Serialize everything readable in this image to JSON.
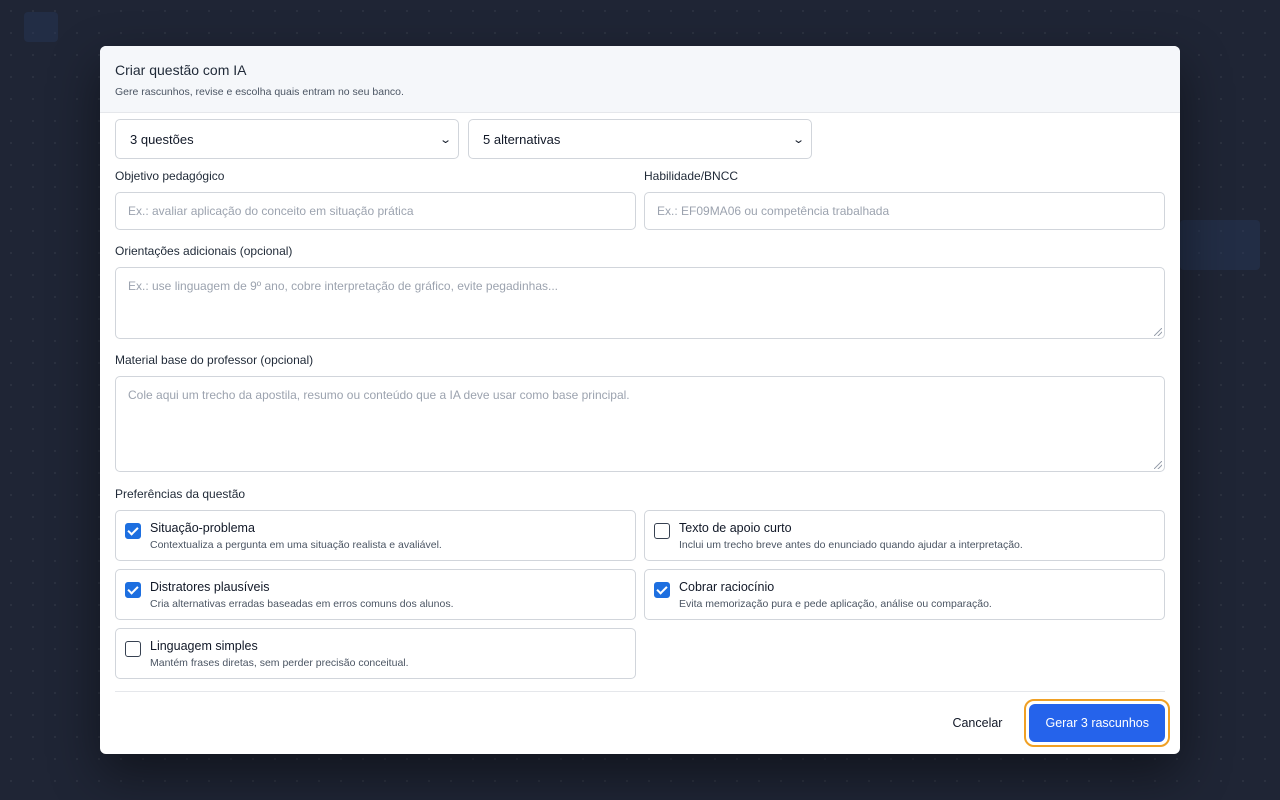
{
  "modal": {
    "title": "Criar questão com IA",
    "subtitle": "Gere rascunhos, revise e escolha quais entram no seu banco."
  },
  "selects": {
    "quantity": "3 questões",
    "alternatives": "5 alternativas"
  },
  "fields": {
    "objective_label": "Objetivo pedagógico",
    "objective_placeholder": "Ex.: avaliar aplicação do conceito em situação prática",
    "skill_label": "Habilidade/BNCC",
    "skill_placeholder": "Ex.: EF09MA06 ou competência trabalhada",
    "guidance_label": "Orientações adicionais (opcional)",
    "guidance_placeholder": "Ex.: use linguagem de 9º ano, cobre interpretação de gráfico, evite pegadinhas...",
    "material_label": "Material base do professor (opcional)",
    "material_placeholder": "Cole aqui um trecho da apostila, resumo ou conteúdo que a IA deve usar como base principal."
  },
  "preferences": {
    "label": "Preferências da questão",
    "items": [
      {
        "title": "Situação-problema",
        "desc": "Contextualiza a pergunta em uma situação realista e avaliável.",
        "checked": true
      },
      {
        "title": "Texto de apoio curto",
        "desc": "Inclui um trecho breve antes do enunciado quando ajudar a interpretação.",
        "checked": false
      },
      {
        "title": "Distratores plausíveis",
        "desc": "Cria alternativas erradas baseadas em erros comuns dos alunos.",
        "checked": true
      },
      {
        "title": "Cobrar raciocínio",
        "desc": "Evita memorização pura e pede aplicação, análise ou comparação.",
        "checked": true
      },
      {
        "title": "Linguagem simples",
        "desc": "Mantém frases diretas, sem perder precisão conceitual.",
        "checked": false
      }
    ]
  },
  "footer": {
    "cancel_label": "Cancelar",
    "submit_label": "Gerar 3 rascunhos"
  },
  "colors": {
    "primary": "#2563eb",
    "focus_ring": "#f0a024",
    "checkbox_checked": "#1d6fe0"
  }
}
